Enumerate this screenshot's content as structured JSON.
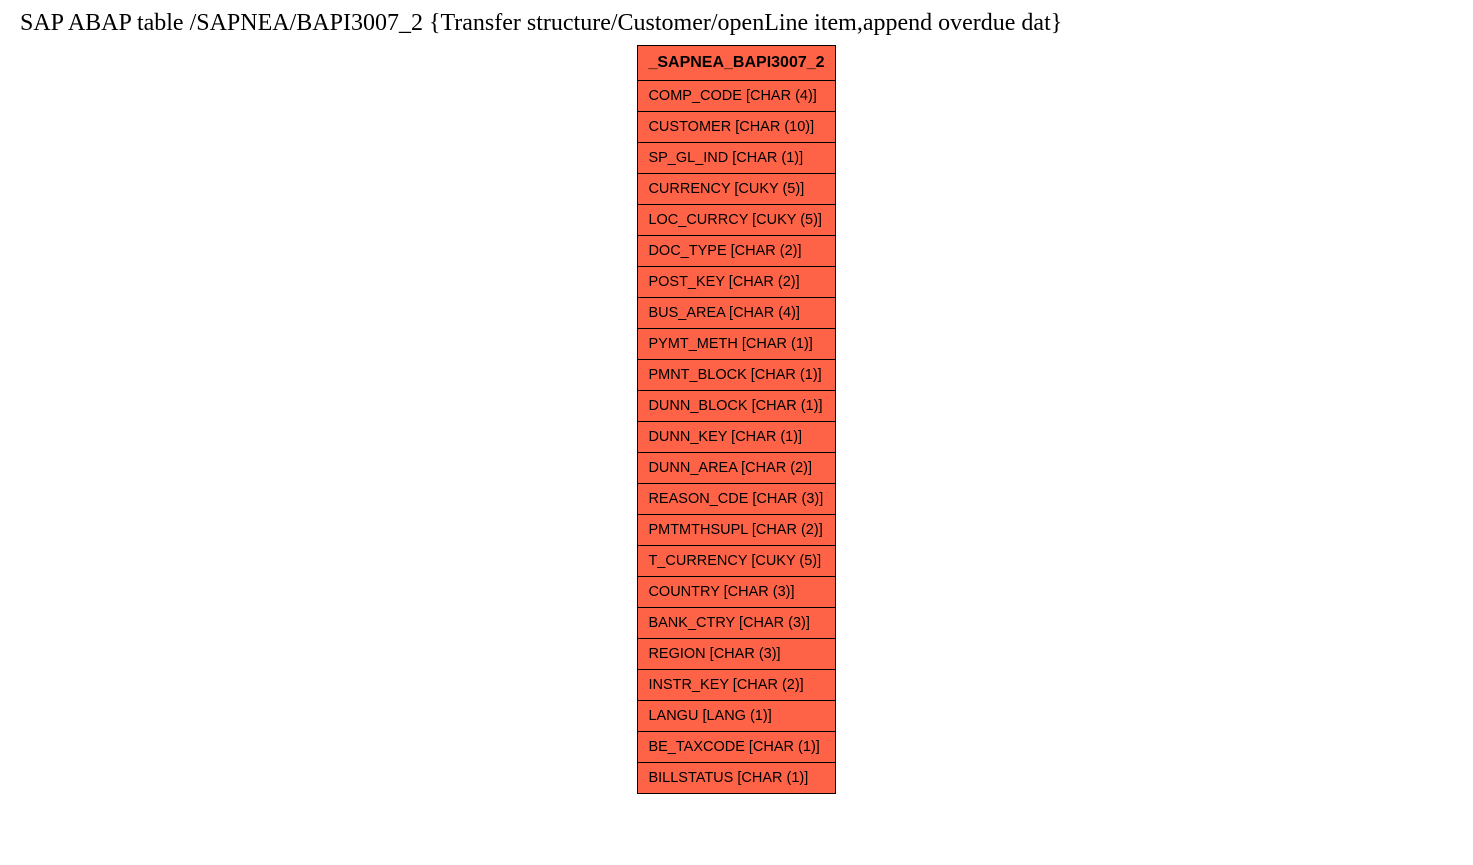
{
  "title": "SAP ABAP table /SAPNEA/BAPI3007_2 {Transfer structure/Customer/openLine item,append overdue dat}",
  "table": {
    "header": "_SAPNEA_BAPI3007_2",
    "fields": [
      "COMP_CODE [CHAR (4)]",
      "CUSTOMER [CHAR (10)]",
      "SP_GL_IND [CHAR (1)]",
      "CURRENCY [CUKY (5)]",
      "LOC_CURRCY [CUKY (5)]",
      "DOC_TYPE [CHAR (2)]",
      "POST_KEY [CHAR (2)]",
      "BUS_AREA [CHAR (4)]",
      "PYMT_METH [CHAR (1)]",
      "PMNT_BLOCK [CHAR (1)]",
      "DUNN_BLOCK [CHAR (1)]",
      "DUNN_KEY [CHAR (1)]",
      "DUNN_AREA [CHAR (2)]",
      "REASON_CDE [CHAR (3)]",
      "PMTMTHSUPL [CHAR (2)]",
      "T_CURRENCY [CUKY (5)]",
      "COUNTRY [CHAR (3)]",
      "BANK_CTRY [CHAR (3)]",
      "REGION [CHAR (3)]",
      "INSTR_KEY [CHAR (2)]",
      "LANGU [LANG (1)]",
      "BE_TAXCODE [CHAR (1)]",
      "BILLSTATUS [CHAR (1)]"
    ]
  }
}
